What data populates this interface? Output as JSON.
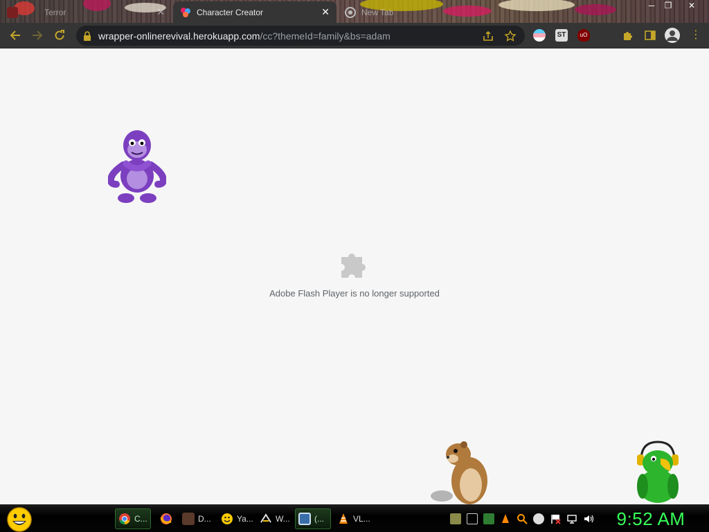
{
  "browser": {
    "tabs": [
      {
        "label": "Terror",
        "state": "inactive"
      },
      {
        "label": "Character Creator",
        "state": "active"
      },
      {
        "label": "New Tab",
        "state": "inactive"
      }
    ],
    "window_controls": {
      "minimize": "─",
      "restore": "❐",
      "close": "✕"
    },
    "address": {
      "host": "wrapper-onlinerevival.herokuapp.com",
      "path": "/cc?themeId=family&bs=adam"
    }
  },
  "page": {
    "plugin_message": "Adobe Flash Player is no longer supported"
  },
  "taskbar": {
    "tasks": [
      {
        "label": "C...",
        "icon": "chrome-icon",
        "active": true
      },
      {
        "label": "",
        "icon": "firefox-icon",
        "active": false
      },
      {
        "label": "D...",
        "icon": "document-icon",
        "active": false
      },
      {
        "label": "Ya...",
        "icon": "yahoo-messenger-icon",
        "active": false
      },
      {
        "label": "W...",
        "icon": "winamp-icon",
        "active": false
      },
      {
        "label": "(...",
        "icon": "window-icon",
        "active": true
      },
      {
        "label": "VL...",
        "icon": "vlc-icon",
        "active": false
      }
    ],
    "clock": "9:52 AM"
  },
  "colors": {
    "accent_green": "#38ff5a",
    "toolbar": "#353535",
    "page_bg": "#f6f6f6"
  }
}
